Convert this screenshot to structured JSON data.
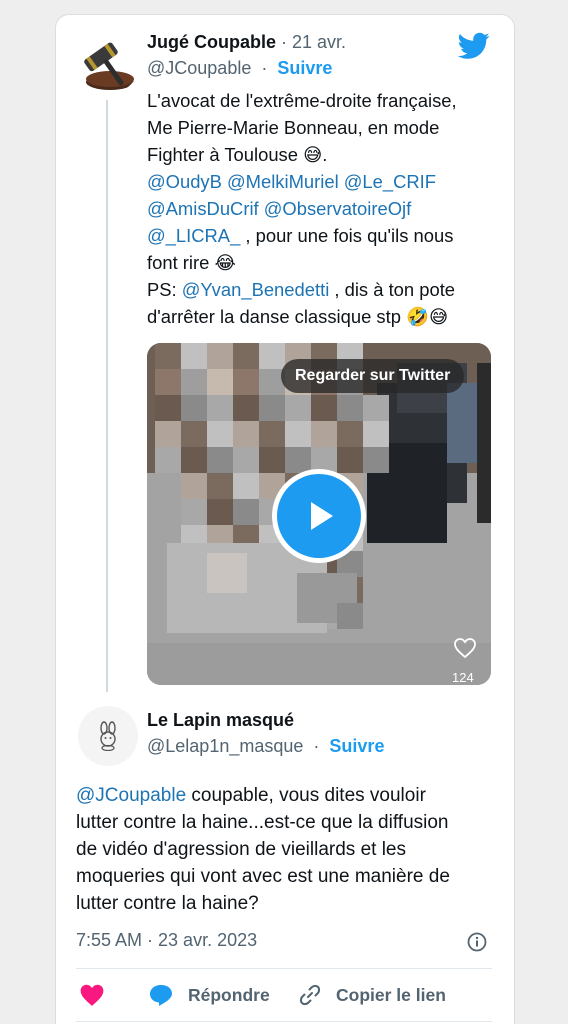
{
  "tweet": {
    "author_name": "Jugé Coupable",
    "separator": "·",
    "date": "21 avr.",
    "handle": "@JCoupable",
    "follow_label": "Suivre",
    "text_lines": [
      [
        {
          "t": "L'avocat de l'extrême-droite française,",
          "m": false
        }
      ],
      [
        {
          "t": "Me Pierre-Marie Bonneau, en mode",
          "m": false
        }
      ],
      [
        {
          "t": "Fighter à Toulouse 😅.",
          "m": false
        }
      ],
      [
        {
          "t": "@OudyB @MelkiMuriel @Le_CRIF",
          "m": true
        }
      ],
      [
        {
          "t": "@AmisDuCrif @ObservatoireOjf",
          "m": true
        }
      ],
      [
        {
          "t": "@_LICRA_",
          "m": true
        },
        {
          "t": " ,  pour une fois qu'ils nous",
          "m": false
        }
      ],
      [
        {
          "t": "font rire 😂",
          "m": false
        }
      ],
      [
        {
          "t": "PS: ",
          "m": false
        },
        {
          "t": "@Yvan_Benedetti",
          "m": true
        },
        {
          "t": " , dis à ton pote",
          "m": false
        }
      ],
      [
        {
          "t": "d'arrêter la danse classique stp 🤣😅",
          "m": false
        }
      ]
    ],
    "media": {
      "watch_label": "Regarder sur Twitter",
      "like_count": "124"
    }
  },
  "reply": {
    "author_name": "Le Lapin masqué",
    "handle": "@Lelap1n_masque",
    "separator": "·",
    "follow_label": "Suivre",
    "text_lines": [
      [
        {
          "t": "@JCoupable",
          "m": true
        },
        {
          "t": "  coupable, vous dites vouloir",
          "m": false
        }
      ],
      [
        {
          "t": "lutter contre la haine...est-ce que la diffusion",
          "m": false
        }
      ],
      [
        {
          "t": "de vidéo d'agression de vieillards et les",
          "m": false
        }
      ],
      [
        {
          "t": "moqueries qui vont avec est une manière de",
          "m": false
        }
      ],
      [
        {
          "t": "lutter contre la haine?",
          "m": false
        }
      ]
    ],
    "timestamp": "7:55 AM · 23 avr. 2023"
  },
  "actions": {
    "reply_label": "Répondre",
    "copy_label": "Copier le lien"
  },
  "colors": {
    "accent": "#1d9bf0",
    "mention": "#1d74b5",
    "like": "#f91880",
    "muted": "#536471"
  },
  "icons": [
    "gavel-avatar",
    "twitter-bird-icon",
    "play-icon",
    "heart-outline-icon",
    "bunny-avatar",
    "info-icon",
    "heart-icon",
    "reply-bubble-icon",
    "link-icon"
  ]
}
